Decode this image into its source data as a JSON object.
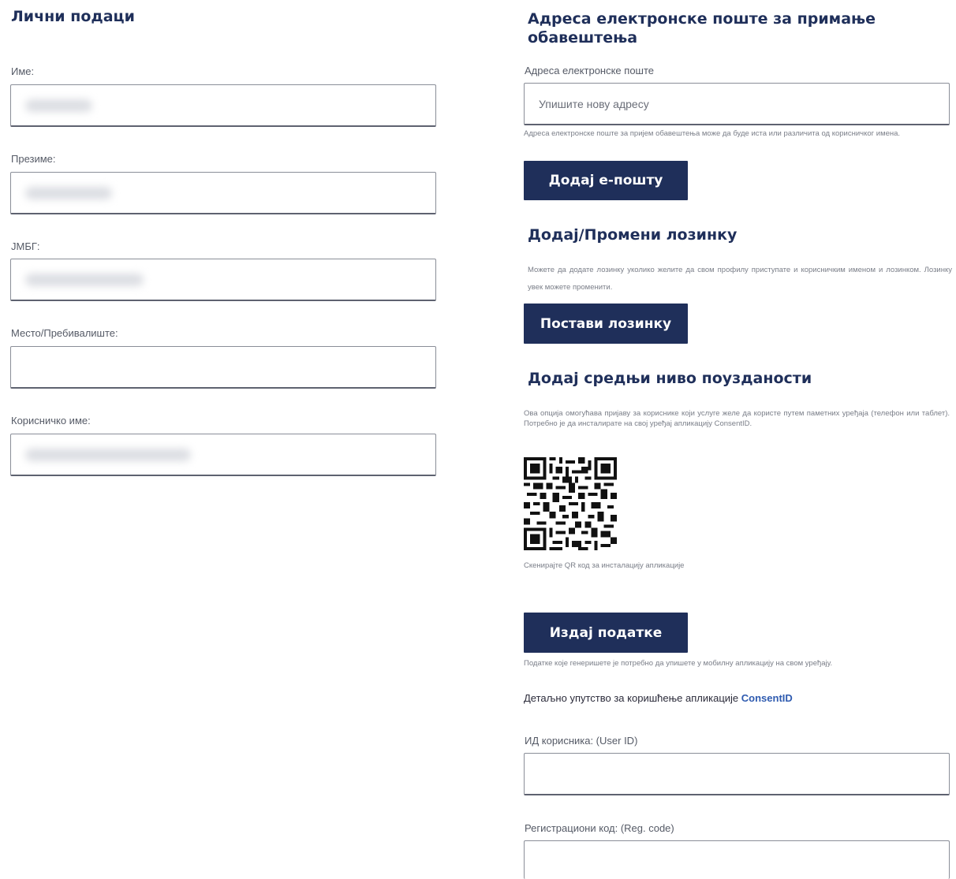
{
  "personal": {
    "title": "Лични подаци",
    "first_name_label": "Име:",
    "last_name_label": "Презиме:",
    "jmbg_label": "ЈМБГ:",
    "residence_label": "Место/Пребивалиште:",
    "username_label": "Корисничко име:"
  },
  "email": {
    "title_line1": "Адреса електронске поште за примање",
    "title_line2": "обавештења",
    "field_label": "Адреса електронске поште",
    "placeholder": "Упишите нову адресу",
    "help": "Адреса електронске поште за пријем обавештења може да буде иста или различита од корисничког имена.",
    "button": "Додај е-пошту"
  },
  "password": {
    "title": "Додај/Промени лозинку",
    "desc": "Можете да додате лозинку уколико желите да свом профилу приступате и корисничким именом и лозинком. Лозинку увек можете променити.",
    "button": "Постави лозинку"
  },
  "assurance": {
    "title": "Додај средњи ниво поузданости",
    "desc": "Ова опција омогућава пријаву за кориснике који услуге желе да користе путем паметних уређаја (телефон или таблет). Потребно је да инсталирате на свој уређај апликацију ConsentID.",
    "qr_caption": "Скенирајте QR код за инсталацију апликације",
    "button": "Издај податке",
    "data_note": "Податке које генеришете је потребно да упишете у мобилну апликацију на свом уређају.",
    "guide_text": "Детаљно упутство за коришћење апликације",
    "guide_link": "ConsentID",
    "user_id_label": "ИД корисника: (User ID)",
    "reg_code_label": "Регистрациони код: (Reg. code)"
  },
  "icons": {
    "qr": "qr-code-icon"
  },
  "colors": {
    "primary": "#1f2f5a",
    "link": "#2f5bb0"
  }
}
